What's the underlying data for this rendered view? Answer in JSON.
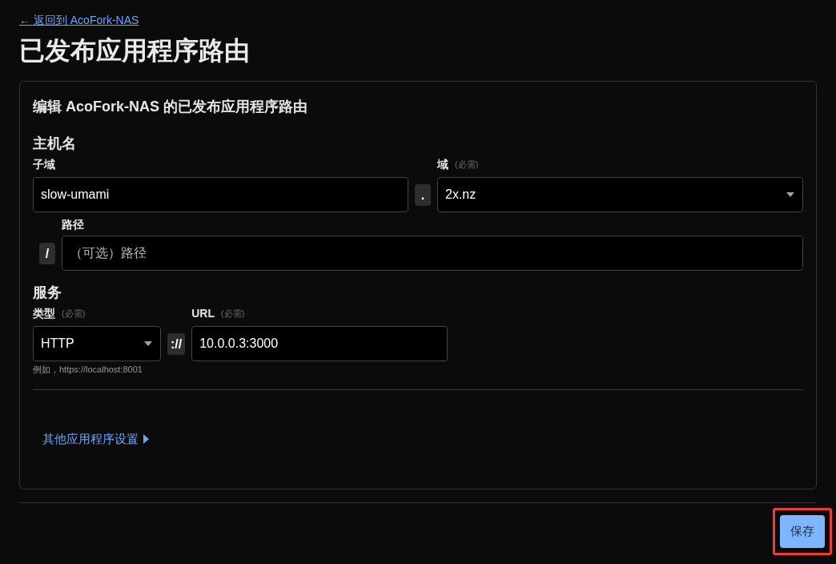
{
  "back_link": "← 返回到 AcoFork-NAS",
  "title": "已发布应用程序路由",
  "card": {
    "heading": "编辑 AcoFork-NAS 的已发布应用程序路由",
    "hostname": {
      "heading": "主机名",
      "subdomain": {
        "label": "子域",
        "value": "slow-umami"
      },
      "separator": ".",
      "domain": {
        "label": "域",
        "required": "(必需)",
        "value": "2x.nz"
      },
      "path": {
        "label": "路径",
        "prefix": "/",
        "placeholder": "（可选）路径"
      }
    },
    "service": {
      "heading": "服务",
      "type": {
        "label": "类型",
        "required": "(必需)",
        "value": "HTTP",
        "hint": "例如，https://localhost:8001"
      },
      "separator": "://",
      "url": {
        "label": "URL",
        "required": "(必需)",
        "value": "10.0.0.3:3000"
      }
    },
    "more_settings": {
      "label": "其他应用程序设置",
      "expanded": false
    }
  },
  "save_button": {
    "label": "保存",
    "highlighted": true
  }
}
